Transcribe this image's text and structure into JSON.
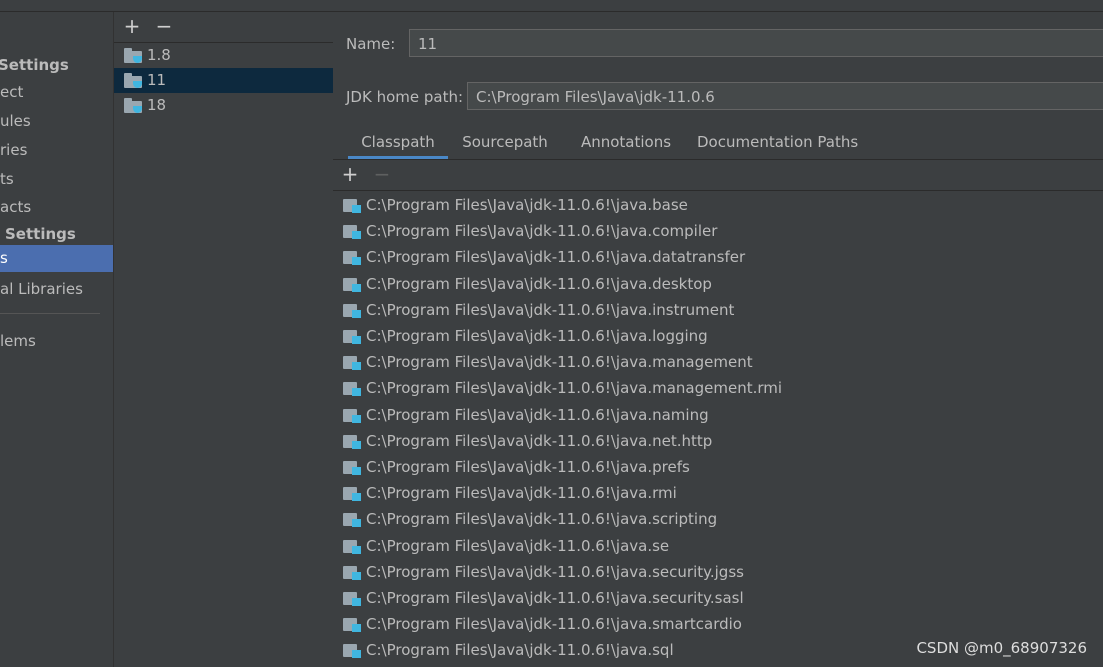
{
  "sidebar": {
    "items": [
      {
        "label": "Settings"
      },
      {
        "label": "ect"
      },
      {
        "label": "ules"
      },
      {
        "label": "ries"
      },
      {
        "label": "ts"
      },
      {
        "label": "acts"
      },
      {
        "label": "Settings"
      },
      {
        "label": "s"
      },
      {
        "label": "al Libraries"
      },
      {
        "label": "lems"
      }
    ]
  },
  "sdk_list": {
    "add_label": "+",
    "remove_label": "−",
    "items": [
      {
        "label": "1.8"
      },
      {
        "label": "11"
      },
      {
        "label": "18"
      }
    ]
  },
  "detail": {
    "name_label": "Name:",
    "name_value": "11",
    "jdk_home_label": "JDK home path:",
    "jdk_home_value": "C:\\Program Files\\Java\\jdk-11.0.6",
    "tabs": [
      {
        "label": "Classpath"
      },
      {
        "label": "Sourcepath"
      },
      {
        "label": "Annotations"
      },
      {
        "label": "Documentation Paths"
      }
    ],
    "toolbar": {
      "add_label": "+",
      "remove_label": "−"
    },
    "classpath": [
      "C:\\Program Files\\Java\\jdk-11.0.6!\\java.base",
      "C:\\Program Files\\Java\\jdk-11.0.6!\\java.compiler",
      "C:\\Program Files\\Java\\jdk-11.0.6!\\java.datatransfer",
      "C:\\Program Files\\Java\\jdk-11.0.6!\\java.desktop",
      "C:\\Program Files\\Java\\jdk-11.0.6!\\java.instrument",
      "C:\\Program Files\\Java\\jdk-11.0.6!\\java.logging",
      "C:\\Program Files\\Java\\jdk-11.0.6!\\java.management",
      "C:\\Program Files\\Java\\jdk-11.0.6!\\java.management.rmi",
      "C:\\Program Files\\Java\\jdk-11.0.6!\\java.naming",
      "C:\\Program Files\\Java\\jdk-11.0.6!\\java.net.http",
      "C:\\Program Files\\Java\\jdk-11.0.6!\\java.prefs",
      "C:\\Program Files\\Java\\jdk-11.0.6!\\java.rmi",
      "C:\\Program Files\\Java\\jdk-11.0.6!\\java.scripting",
      "C:\\Program Files\\Java\\jdk-11.0.6!\\java.se",
      "C:\\Program Files\\Java\\jdk-11.0.6!\\java.security.jgss",
      "C:\\Program Files\\Java\\jdk-11.0.6!\\java.security.sasl",
      "C:\\Program Files\\Java\\jdk-11.0.6!\\java.smartcardio",
      "C:\\Program Files\\Java\\jdk-11.0.6!\\java.sql"
    ]
  },
  "watermark": "CSDN @m0_68907326",
  "icons": {
    "sdk_item": "jdk-folder-icon",
    "classpath_item": "jar-module-icon"
  },
  "colors": {
    "background": "#3c3f41",
    "selection_focused": "#4b6eaf",
    "selection_unfocused": "#0d293e",
    "tab_underline": "#4a88c7",
    "icon_accent": "#40b6e0"
  }
}
